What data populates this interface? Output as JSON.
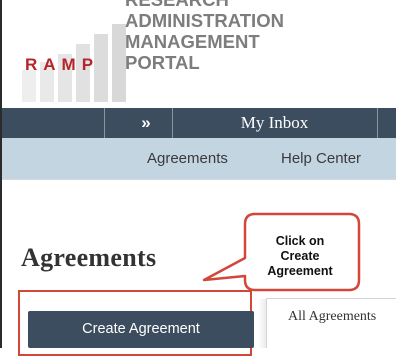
{
  "logo": {
    "mark": "RAMP",
    "lines": [
      "RESEARCH",
      "ADMINISTRATION",
      "MANAGEMENT",
      "PORTAL"
    ]
  },
  "nav": {
    "expand_icon": "double-chevron-right-icon",
    "expand_glyph": "»",
    "inbox_label": "My Inbox"
  },
  "subnav": {
    "agreements_label": "Agreements",
    "help_center_label": "Help Center"
  },
  "page": {
    "title": "Agreements",
    "create_button_label": "Create Agreement",
    "tab_label": "All Agreements"
  },
  "callout": {
    "lines": [
      "Click on",
      "Create",
      "Agreement"
    ]
  },
  "colors": {
    "nav_bg": "#3b4d5e",
    "subnav_bg": "#c4d5e2",
    "callout_border": "#d2473a",
    "logo_red": "#b5252b",
    "logo_gray": "#7d7d7d"
  }
}
